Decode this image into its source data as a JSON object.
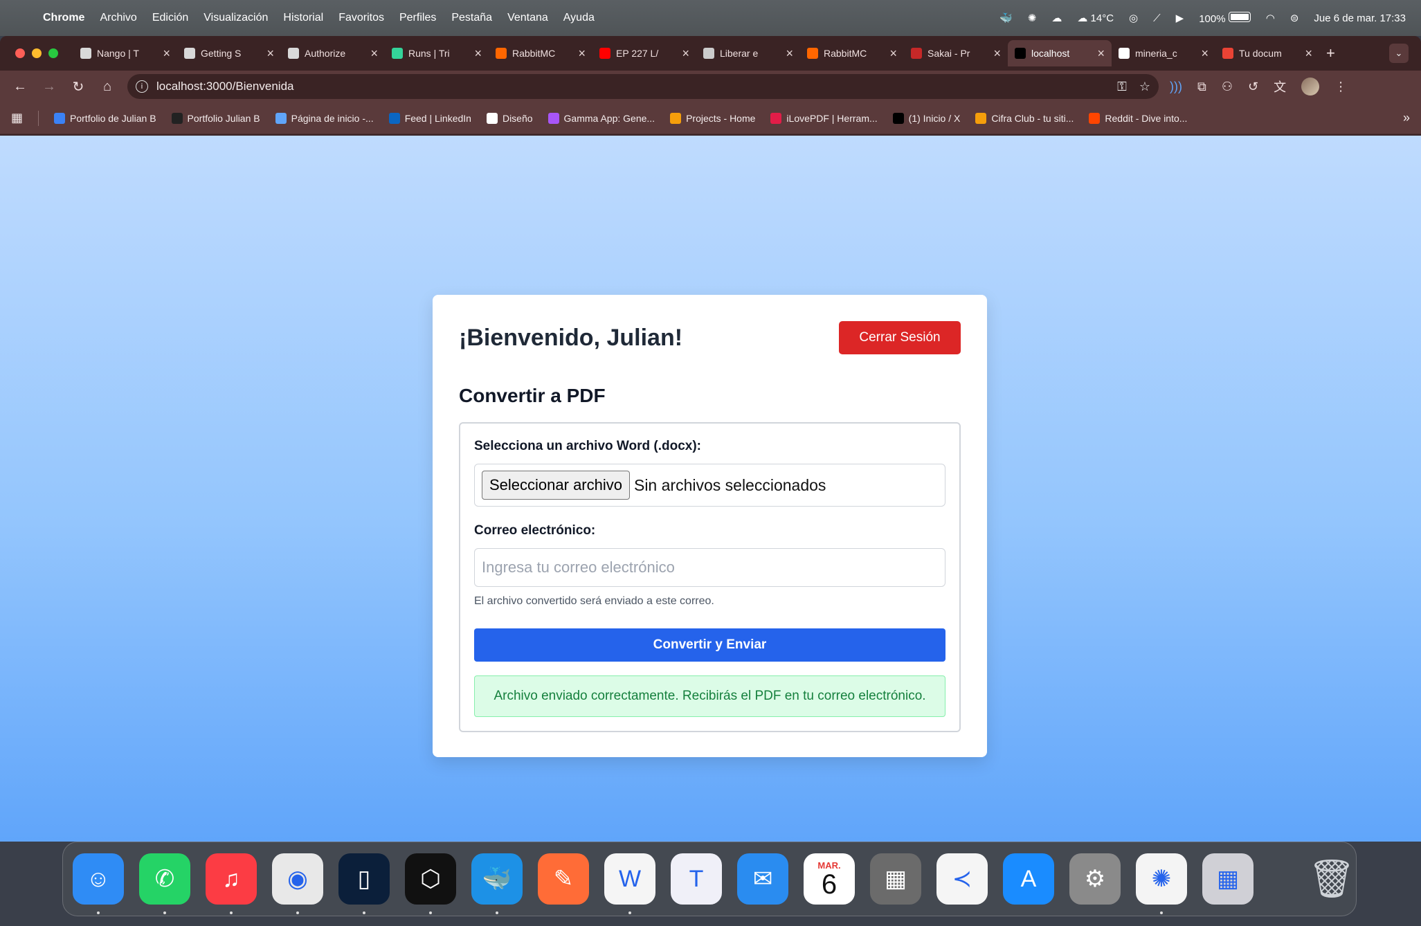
{
  "menubar": {
    "app": "Chrome",
    "items": [
      "Archivo",
      "Edición",
      "Visualización",
      "Historial",
      "Favoritos",
      "Perfiles",
      "Pestaña",
      "Ventana",
      "Ayuda"
    ],
    "temperature": "14°C",
    "battery": "100%",
    "datetime": "Jue 6 de mar.  17:33"
  },
  "tabs": [
    {
      "title": "Nango | T",
      "color": "#d9d9d9"
    },
    {
      "title": "Getting S",
      "color": "#d9d9d9"
    },
    {
      "title": "Authorize",
      "color": "#d9d9d9"
    },
    {
      "title": "Runs | Tri",
      "color": "#34d399"
    },
    {
      "title": "RabbitMC",
      "color": "#ff6600"
    },
    {
      "title": "EP 227 L/",
      "color": "#ff0000"
    },
    {
      "title": "Liberar e",
      "color": "#cccccc"
    },
    {
      "title": "RabbitMC",
      "color": "#ff6600"
    },
    {
      "title": "Sakai - Pr",
      "color": "#c62828"
    },
    {
      "title": "localhost",
      "color": "#000000",
      "active": true
    },
    {
      "title": "mineria_c",
      "color": "#ffffff"
    },
    {
      "title": "Tu docum",
      "color": "#ea4335"
    }
  ],
  "toolbar": {
    "url": "localhost:3000/Bienvenida"
  },
  "bookmarks": [
    {
      "label": "Portfolio de Julian B",
      "color": "#3b82f6"
    },
    {
      "label": "Portfolio Julian B",
      "color": "#222222"
    },
    {
      "label": "Página de inicio -...",
      "color": "#60a5fa"
    },
    {
      "label": "Feed | LinkedIn",
      "color": "#0a66c2"
    },
    {
      "label": "Diseño",
      "color": "#ffffff"
    },
    {
      "label": "Gamma App: Gene...",
      "color": "#a855f7"
    },
    {
      "label": "Projects - Home",
      "color": "#f59e0b"
    },
    {
      "label": "iLovePDF | Herram...",
      "color": "#e11d48"
    },
    {
      "label": "(1) Inicio / X",
      "color": "#000000"
    },
    {
      "label": "Cifra Club - tu siti...",
      "color": "#f59e0b"
    },
    {
      "label": "Reddit - Dive into...",
      "color": "#ff4500"
    }
  ],
  "page": {
    "welcome": "¡Bienvenido, Julian!",
    "logout_label": "Cerrar Sesión",
    "section_title": "Convertir a PDF",
    "file_label": "Selecciona un archivo Word (.docx):",
    "file_button": "Seleccionar archivo",
    "file_status": "Sin archivos seleccionados",
    "email_label": "Correo electrónico:",
    "email_placeholder": "Ingresa tu correo electrónico",
    "email_value": "",
    "hint": "El archivo convertido será enviado a este correo.",
    "submit_label": "Convertir y Enviar",
    "success_message": "Archivo enviado correctamente. Recibirás el PDF en tu correo electrónico."
  },
  "dock": [
    {
      "name": "finder-icon",
      "glyph": "☺",
      "bg": "#2f8cf5",
      "running": true
    },
    {
      "name": "whatsapp-icon",
      "glyph": "✆",
      "bg": "#25d366",
      "running": true
    },
    {
      "name": "music-icon",
      "glyph": "♫",
      "bg": "#fc3c44",
      "running": true
    },
    {
      "name": "chrome-icon",
      "glyph": "◉",
      "bg": "#e8e8e8",
      "running": true
    },
    {
      "name": "notes-app-icon",
      "glyph": "▯",
      "bg": "#0b1f3a",
      "running": true
    },
    {
      "name": "cube-app-icon",
      "glyph": "⬡",
      "bg": "#111111",
      "running": true
    },
    {
      "name": "docker-icon",
      "glyph": "🐳",
      "bg": "#1d91e6",
      "running": true
    },
    {
      "name": "postman-icon",
      "glyph": "✎",
      "bg": "#ff6c37",
      "running": false
    },
    {
      "name": "word-icon",
      "glyph": "W",
      "bg": "#f5f5f5",
      "running": true
    },
    {
      "name": "teams-icon",
      "glyph": "T",
      "bg": "#f0f0f8",
      "running": false
    },
    {
      "name": "mail-icon",
      "glyph": "✉",
      "bg": "#2a8cf0",
      "running": false
    },
    {
      "name": "calendar-icon",
      "month": "MAR.",
      "day": "6",
      "calendar": true,
      "running": false
    },
    {
      "name": "calculator-icon",
      "glyph": "▦",
      "bg": "#6b6b6b",
      "running": false
    },
    {
      "name": "vscode-icon",
      "glyph": "≺",
      "bg": "#f5f5f5",
      "running": false
    },
    {
      "name": "app-store-icon",
      "glyph": "A",
      "bg": "#1a8cff",
      "running": false
    },
    {
      "name": "system-settings-icon",
      "glyph": "⚙",
      "bg": "#8a8a8a",
      "running": false
    },
    {
      "name": "chatgpt-icon",
      "glyph": "✺",
      "bg": "#f4f4f4",
      "running": true
    },
    {
      "name": "launchpad-icon",
      "glyph": "▦",
      "bg": "#d0d0d6",
      "running": false
    }
  ]
}
